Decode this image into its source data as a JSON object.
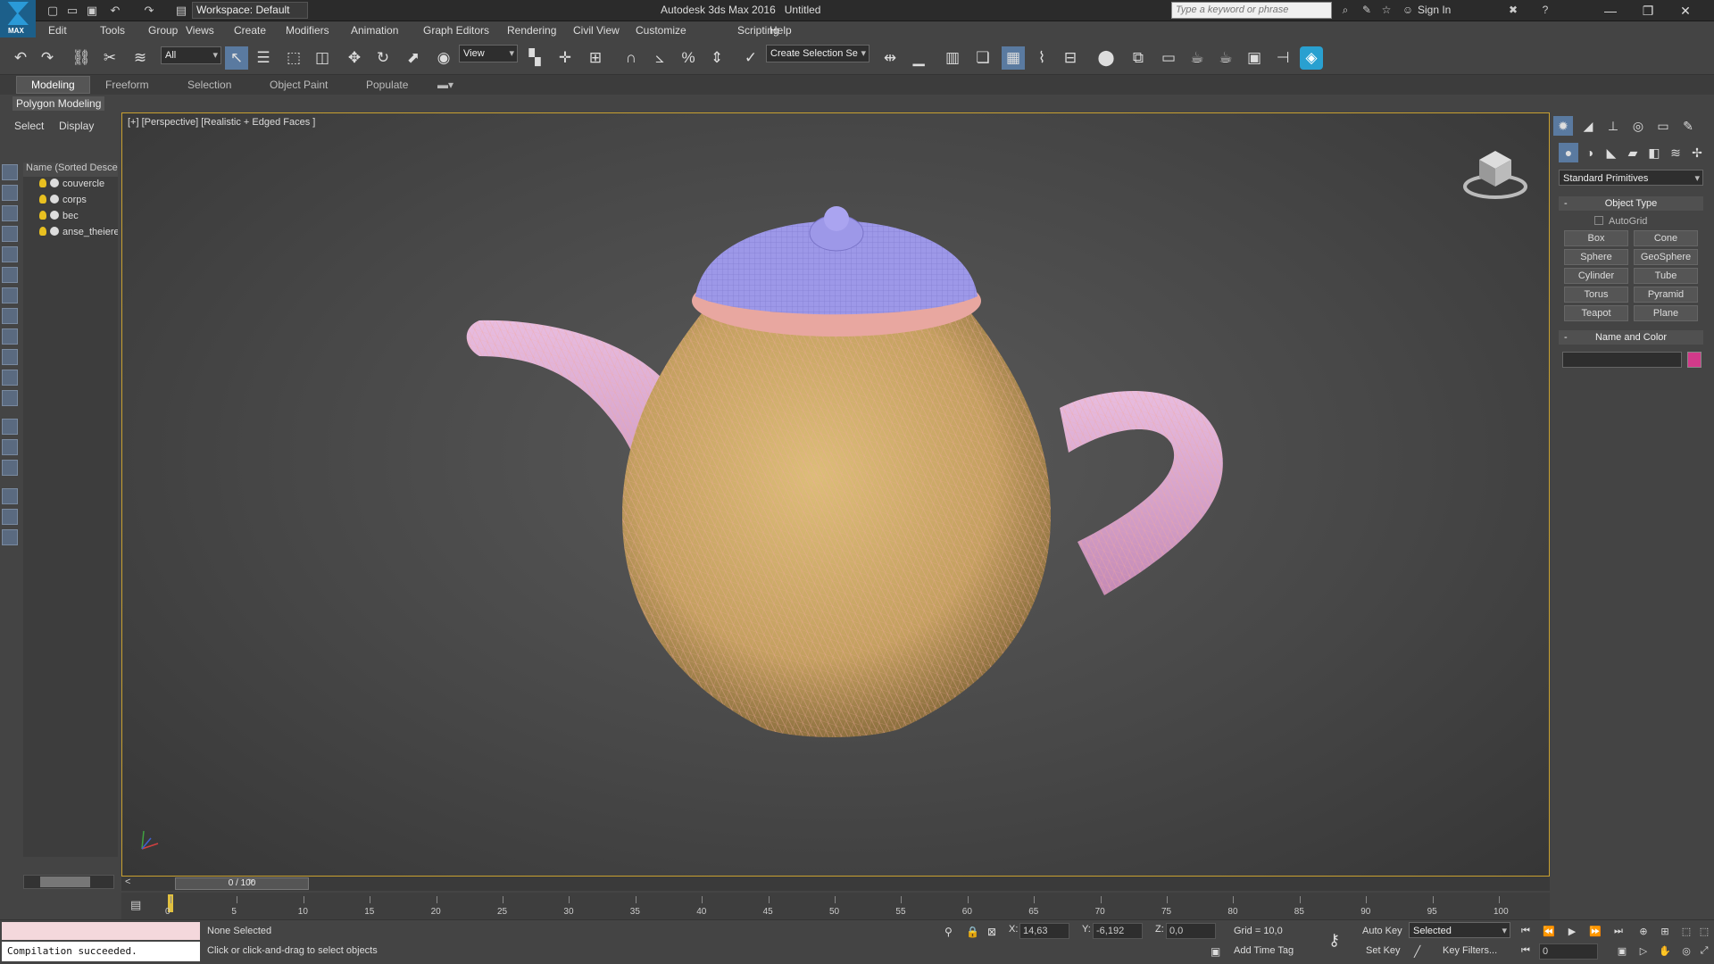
{
  "title": {
    "workspace": "Workspace: Default",
    "app_title": "Autodesk 3ds Max 2016",
    "doc_title": "Untitled",
    "search_placeholder": "Type a keyword or phrase",
    "sign_in": "Sign In",
    "logo_text": "MAX"
  },
  "menu": [
    "Edit",
    "Tools",
    "Group",
    "Views",
    "Create",
    "Modifiers",
    "Animation",
    "Graph Editors",
    "Rendering",
    "Civil View",
    "Customize",
    "Scripting",
    "Help"
  ],
  "toolbar": {
    "filter": "All",
    "ref_coord": "View",
    "selection_set": "Create Selection Se"
  },
  "ribbon": {
    "tabs": [
      "Modeling",
      "Freeform",
      "Selection",
      "Object Paint",
      "Populate"
    ],
    "panel": "Polygon Modeling"
  },
  "scene_explorer": {
    "tabs": [
      "Select",
      "Display"
    ],
    "header": "Name (Sorted Descending)",
    "items": [
      "couvercle",
      "corps",
      "bec",
      "anse_theiere"
    ]
  },
  "viewport": {
    "label": "[+] [Perspective] [Realistic + Edged Faces ]",
    "colors": {
      "lid": "#9d98e8",
      "body": "#c9a866",
      "spout_handle": "#d7a7c9",
      "wire": "#f2a8a0"
    }
  },
  "command_panel": {
    "category": "Standard Primitives",
    "object_type_title": "Object Type",
    "autogrid": "AutoGrid",
    "buttons": [
      "Box",
      "Cone",
      "Sphere",
      "GeoSphere",
      "Cylinder",
      "Tube",
      "Torus",
      "Pyramid",
      "Teapot",
      "Plane"
    ],
    "name_color_title": "Name and Color",
    "object_color": "#d23a8a"
  },
  "timeline": {
    "frame": "0 / 100",
    "ticks": [
      "0",
      "5",
      "10",
      "15",
      "20",
      "25",
      "30",
      "35",
      "40",
      "45",
      "50",
      "55",
      "60",
      "65",
      "70",
      "75",
      "80",
      "85",
      "90",
      "95",
      "100"
    ]
  },
  "status": {
    "script_output": "Compilation succeeded.",
    "selection": "None Selected",
    "hint": "Click or click-and-drag to select objects",
    "x_label": "X:",
    "x": "14,63",
    "y_label": "Y:",
    "y": "-6,192",
    "z_label": "Z:",
    "z": "0,0",
    "grid": "Grid = 10,0",
    "add_time_tag": "Add Time Tag",
    "auto_key": "Auto Key",
    "set_key": "Set Key",
    "key_mode": "Selected",
    "key_filters": "Key Filters...",
    "current_frame": "0"
  }
}
